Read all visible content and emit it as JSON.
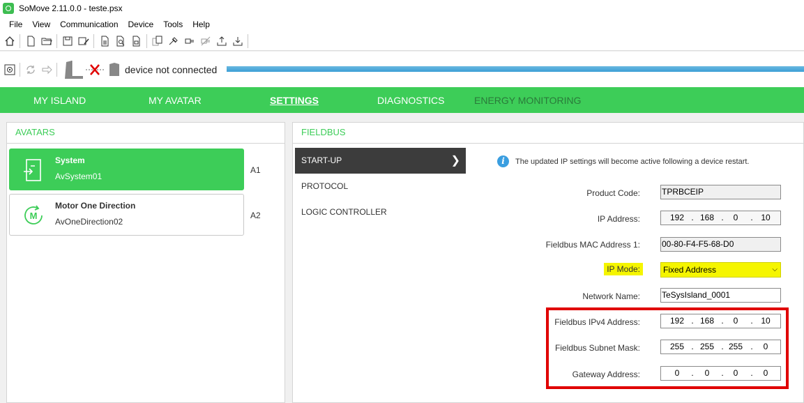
{
  "window": {
    "title": "SoMove 2.11.0.0 - teste.psx"
  },
  "menu": [
    "File",
    "View",
    "Communication",
    "Device",
    "Tools",
    "Help"
  ],
  "toolbar": {
    "icons": [
      "home-icon",
      "new-file-icon",
      "open-folder-icon",
      "save-icon",
      "save-as-icon",
      "print-icon",
      "print-preview-icon",
      "page-setup-icon",
      "compare-icon",
      "connect-icon",
      "disconnect-icon",
      "plug-icon",
      "unplug-icon",
      "upload-icon",
      "download-icon"
    ]
  },
  "connection": {
    "status": "device not connected"
  },
  "nav": {
    "tabs": [
      {
        "label": "MY ISLAND"
      },
      {
        "label": "MY AVATAR"
      },
      {
        "label": "SETTINGS",
        "active": true
      },
      {
        "label": "DIAGNOSTICS"
      },
      {
        "label": "ENERGY MONITORING"
      }
    ]
  },
  "avatars": {
    "header": "AVATARS",
    "items": [
      {
        "name": "System",
        "id": "AvSystem01",
        "slot": "A1",
        "selected": true,
        "icon": "system-icon"
      },
      {
        "name": "Motor One Direction",
        "id": "AvOneDirection02",
        "slot": "A2",
        "selected": false,
        "icon": "motor-icon"
      }
    ]
  },
  "fieldbus": {
    "header": "FIELDBUS",
    "submenu": [
      {
        "label": "START-UP",
        "active": true
      },
      {
        "label": "PROTOCOL"
      },
      {
        "label": "LOGIC CONTROLLER"
      }
    ],
    "info": "The updated IP settings will become active following a device restart.",
    "fields": {
      "product_code": {
        "label": "Product Code:",
        "value": "TPRBCEIP"
      },
      "ip_address": {
        "label": "IP Address:",
        "octets": [
          "192",
          "168",
          "0",
          "10"
        ]
      },
      "mac": {
        "label": "Fieldbus MAC Address 1:",
        "value": "00-80-F4-F5-68-D0"
      },
      "ip_mode": {
        "label": "IP Mode:",
        "value": "Fixed Address"
      },
      "network_name": {
        "label": "Network Name:",
        "value": "TeSysIsland_0001"
      },
      "ipv4": {
        "label": "Fieldbus IPv4 Address:",
        "octets": [
          "192",
          "168",
          "0",
          "10"
        ]
      },
      "subnet": {
        "label": "Fieldbus Subnet Mask:",
        "octets": [
          "255",
          "255",
          "255",
          "0"
        ]
      },
      "gateway": {
        "label": "Gateway Address:",
        "octets": [
          "0",
          "0",
          "0",
          "0"
        ]
      }
    }
  },
  "colors": {
    "brand_green": "#3dcd58",
    "highlight_yellow": "#f5f500",
    "frame_red": "#e00000",
    "info_blue": "#3a9ee0"
  }
}
